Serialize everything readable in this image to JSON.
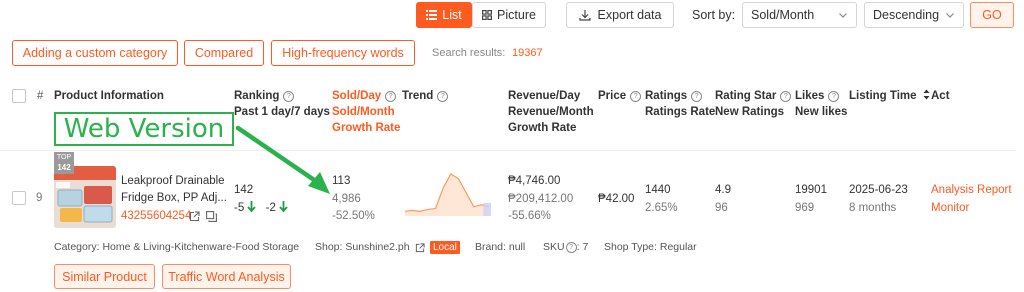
{
  "toolbar": {
    "list_label": "List",
    "picture_label": "Picture",
    "export_label": "Export data",
    "sort_by_label": "Sort by:",
    "sort_field": "Sold/Month",
    "sort_order": "Descending",
    "go_label": "GO"
  },
  "actions": {
    "custom_category": "Adding a custom category",
    "compared": "Compared",
    "high_frequency": "High-frequency words",
    "search_results_label": "Search results:",
    "search_results_count": "19367"
  },
  "columns": {
    "index": "#",
    "product_info": "Product Information",
    "ranking": "Ranking",
    "ranking_sub": "Past 1 day/7 days",
    "sold_day": "Sold/Day",
    "sold_month": "Sold/Month",
    "growth_rate": "Growth Rate",
    "trend": "Trend",
    "revenue_day": "Revenue/Day",
    "revenue_month": "Revenue/Month",
    "revenue_growth": "Revenue/Month Growth Rate",
    "revenue_growth_1": "Revenue/Month",
    "revenue_growth_2": "Growth Rate",
    "price": "Price",
    "ratings": "Ratings",
    "ratings_rate": "Ratings Rate",
    "rating_star": "Rating Star",
    "new_ratings": "New Ratings",
    "likes": "Likes",
    "new_likes": "New likes",
    "listing_time": "Listing Time",
    "act": "Act"
  },
  "annotation": {
    "label": "Web Version",
    "color": "#2bb24c"
  },
  "row": {
    "index": "9",
    "top_badge": "TOP",
    "top_rank": "142",
    "title_line1": "Leakproof Drainable",
    "title_line2": "Fridge Box, PP Adj...",
    "product_id": "43255604254",
    "rank_day": "142",
    "rank_change_day": "-5",
    "rank_change_week": "-2",
    "sold_day": "113",
    "sold_month": "4,986",
    "sold_growth": "-52.50%",
    "revenue_day": "₱4,746.00",
    "revenue_month": "₱209,412.00",
    "revenue_growth": "-55.66%",
    "price": "₱42.00",
    "ratings": "1440",
    "ratings_rate": "2.65%",
    "rating_star": "4.9",
    "new_ratings": "96",
    "likes": "19901",
    "new_likes": "969",
    "listing_date": "2025-06-23",
    "listing_age": "8 months",
    "analysis_report": "Analysis Report",
    "monitor": "Monitor"
  },
  "meta": {
    "category_label": "Category:",
    "category_value": "Home & Living-Kitchenware-Food Storage",
    "shop_label": "Shop:",
    "shop_value": "Sunshine2.ph",
    "local_badge": "Local",
    "brand_label": "Brand:",
    "brand_value": "null",
    "sku_label": "SKU",
    "sku_value": "7",
    "shop_type_label": "Shop Type:",
    "shop_type_value": "Regular"
  },
  "bottom_buttons": {
    "similar_product": "Similar Product",
    "traffic_word": "Traffic Word Analysis"
  },
  "colors": {
    "accent": "#ff5a1f",
    "green": "#1a9e4b",
    "trend_line": "#ff9a5c",
    "trend_fill": "#ffe7d8"
  },
  "trend_data": [
    5,
    6,
    5,
    7,
    8,
    30,
    45,
    40,
    25,
    10,
    12,
    10
  ]
}
